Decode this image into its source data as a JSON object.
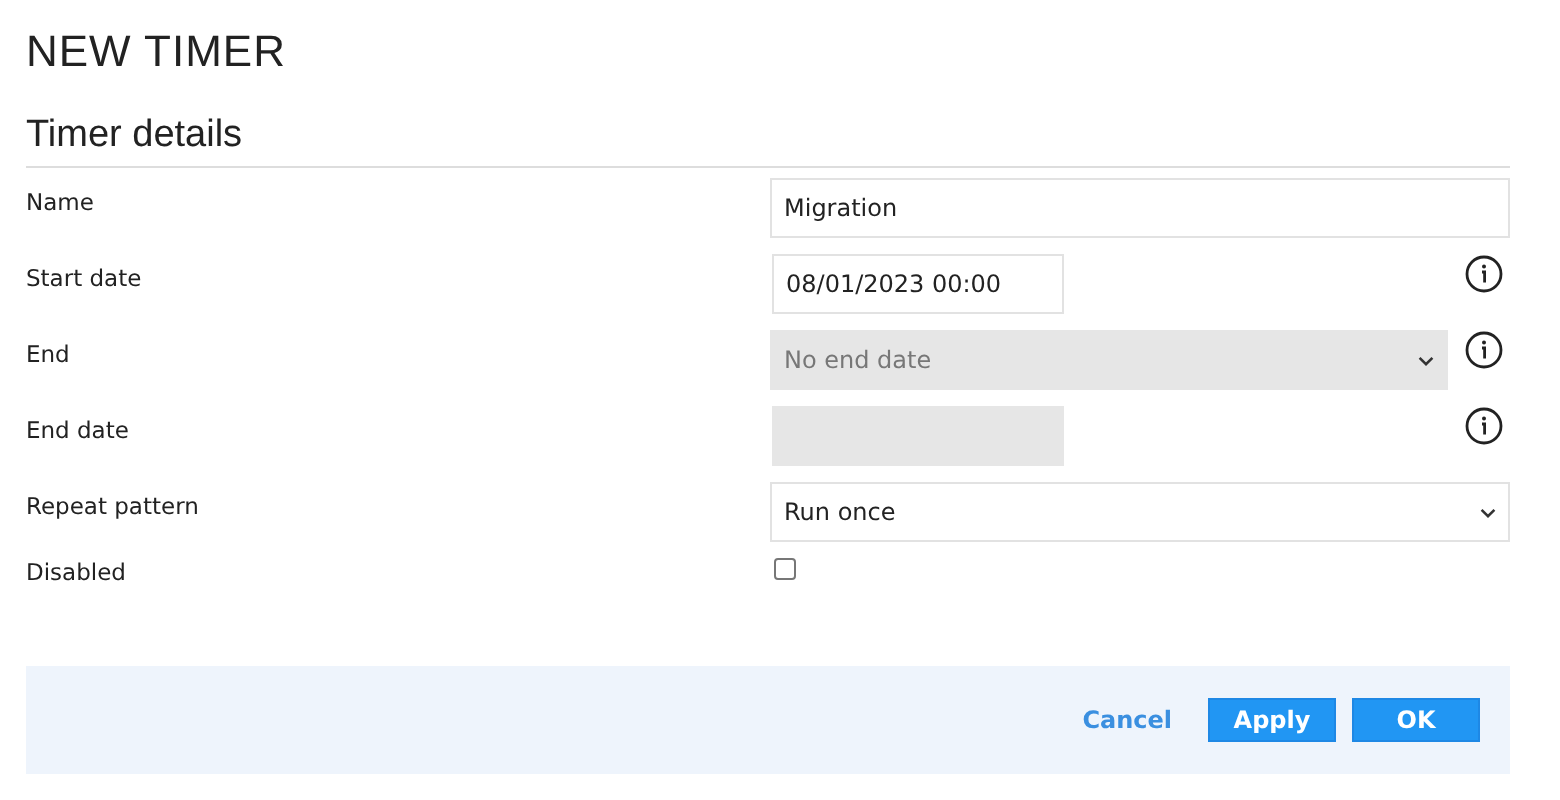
{
  "title": "NEW TIMER",
  "section": "Timer details",
  "fields": [
    {
      "label": "Name",
      "kind": "text",
      "value": "Migration",
      "disabled": false,
      "info": false
    },
    {
      "label": "Start date",
      "kind": "date",
      "value": "08/01/2023 00:00",
      "disabled": false,
      "info": true
    },
    {
      "label": "End",
      "kind": "select",
      "value": "No end date",
      "disabled": true,
      "info": true
    },
    {
      "label": "End date",
      "kind": "date",
      "disabled": true,
      "info": true
    },
    {
      "label": "Repeat pattern",
      "kind": "select",
      "value": "Run once",
      "disabled": false,
      "info": false
    },
    {
      "label": "Disabled",
      "kind": "checkbox",
      "checked": false
    }
  ],
  "buttons": [
    {
      "label": "Cancel",
      "kind": "link"
    },
    {
      "label": "Apply",
      "kind": "primary"
    },
    {
      "label": "OK",
      "kind": "primary"
    }
  ]
}
